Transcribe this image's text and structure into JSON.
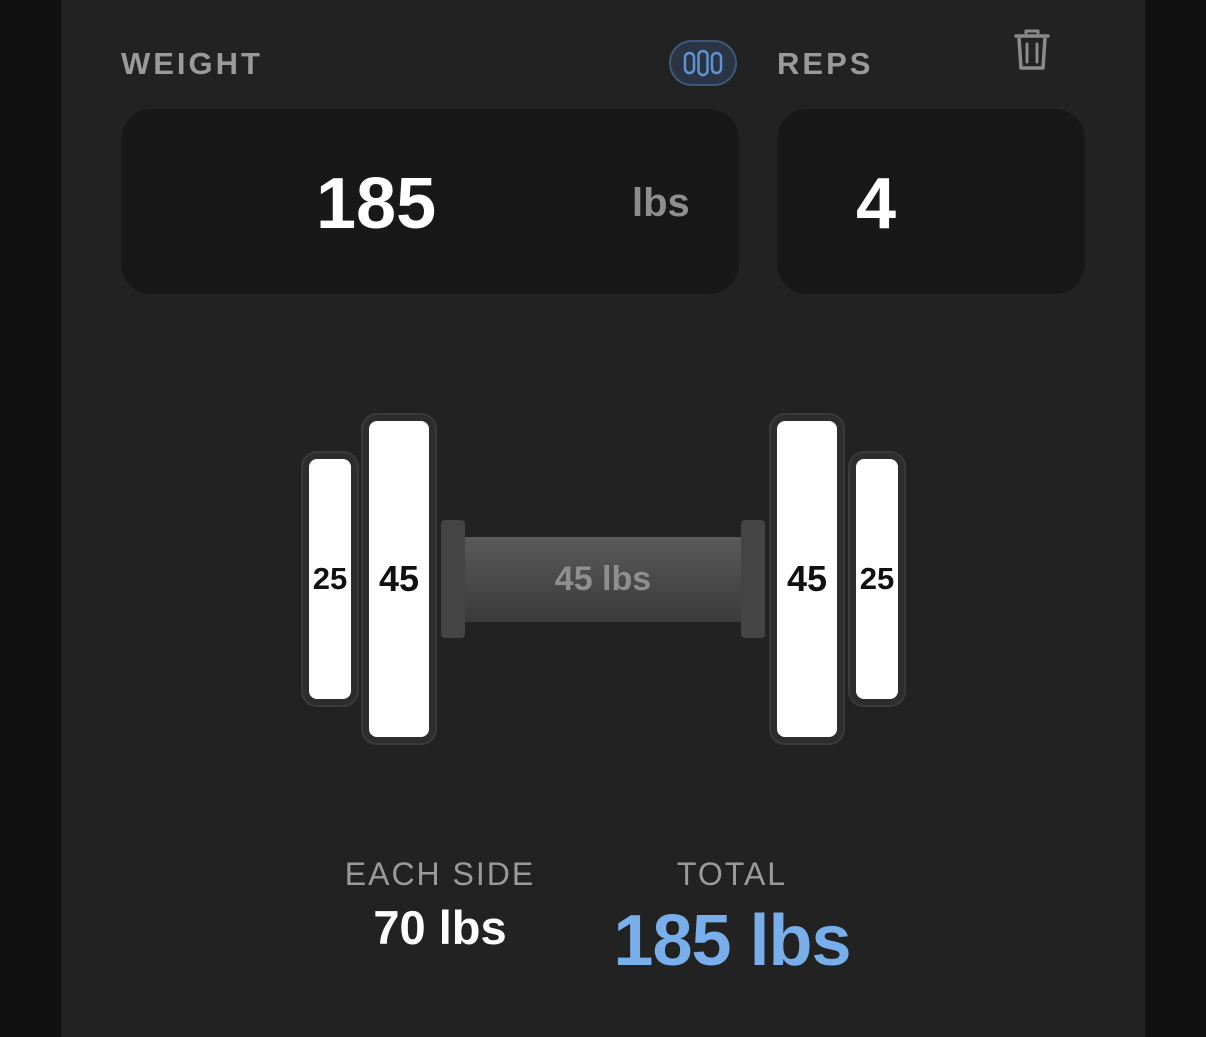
{
  "header": {
    "weight_label": "WEIGHT",
    "reps_label": "REPS",
    "plate_toggle_icon": "plates-icon",
    "delete_icon": "trash-icon"
  },
  "inputs": {
    "weight_value": "185",
    "weight_unit": "lbs",
    "reps_value": "4"
  },
  "barbell": {
    "left_plates": [
      "25",
      "45"
    ],
    "bar_label": "45 lbs",
    "right_plates": [
      "45",
      "25"
    ]
  },
  "summary": {
    "each_side_label": "EACH SIDE",
    "each_side_value": "70 lbs",
    "total_label": "TOTAL",
    "total_value": "185 lbs"
  },
  "colors": {
    "background": "#111111",
    "card": "#222222",
    "input_bg": "#181818",
    "accent": "#78aeea",
    "plate": "#ffffff"
  }
}
